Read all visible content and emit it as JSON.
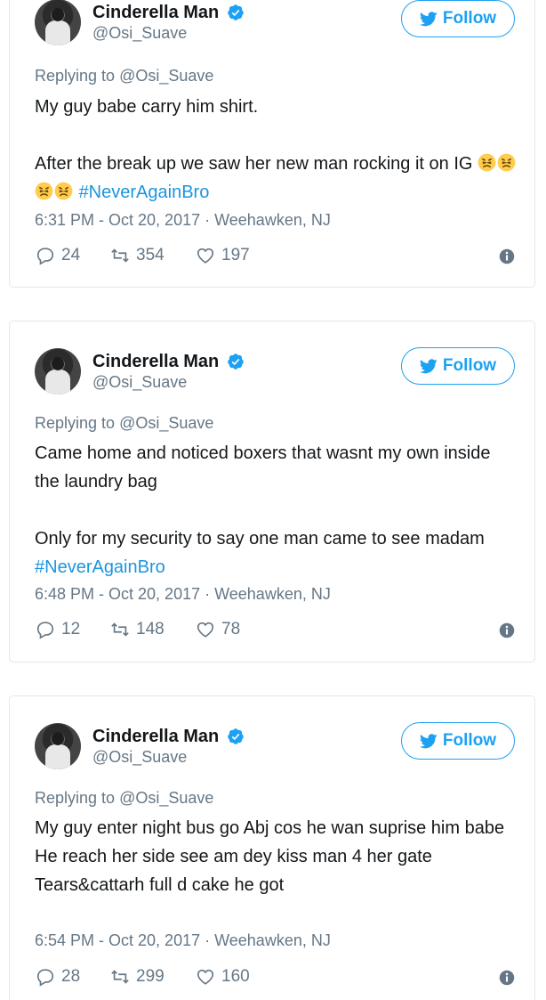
{
  "tweets": [
    {
      "author": {
        "name": "Cinderella Man",
        "handle": "@Osi_Suave"
      },
      "follow_label": "Follow",
      "reply_prefix": "Replying to",
      "reply_handle": "@Osi_Suave",
      "paragraphs": [
        {
          "text": "My guy babe carry him shirt."
        },
        {
          "text": "After the break up we saw her new man rocking it on IG",
          "emoji": "persevering-face-emoji x4",
          "hashtag": "#NeverAgainBro"
        }
      ],
      "timestamp": "6:31 PM - Oct 20, 2017",
      "location": "Weehawken, NJ",
      "stats": {
        "replies": "24",
        "retweets": "354",
        "likes": "197"
      }
    },
    {
      "author": {
        "name": "Cinderella Man",
        "handle": "@Osi_Suave"
      },
      "follow_label": "Follow",
      "reply_prefix": "Replying to",
      "reply_handle": "@Osi_Suave",
      "paragraphs": [
        {
          "text": "Came home and noticed boxers that wasnt my own inside the laundry bag"
        },
        {
          "text": "Only for my security to say one man came to see madam",
          "hashtag": "#NeverAgainBro"
        }
      ],
      "timestamp": "6:48 PM - Oct 20, 2017",
      "location": "Weehawken, NJ",
      "stats": {
        "replies": "12",
        "retweets": "148",
        "likes": "78"
      }
    },
    {
      "author": {
        "name": "Cinderella Man",
        "handle": "@Osi_Suave"
      },
      "follow_label": "Follow",
      "reply_prefix": "Replying to",
      "reply_handle": "@Osi_Suave",
      "lines": [
        "My guy enter night bus go Abj cos he wan suprise him babe",
        "He reach her side see am dey kiss man 4 her gate",
        "Tears&cattarh full d cake he got"
      ],
      "timestamp": "6:54 PM - Oct 20, 2017",
      "location": "Weehawken, NJ",
      "stats": {
        "replies": "28",
        "retweets": "299",
        "likes": "160"
      }
    }
  ],
  "colors": {
    "accent": "#1da1f2",
    "hashtag": "#1b95e0",
    "secondary": "#657786",
    "border": "#e1e8ed"
  },
  "icons": [
    "verified-badge-icon",
    "twitter-bird-icon",
    "reply-icon",
    "retweet-icon",
    "like-heart-icon",
    "info-icon"
  ]
}
